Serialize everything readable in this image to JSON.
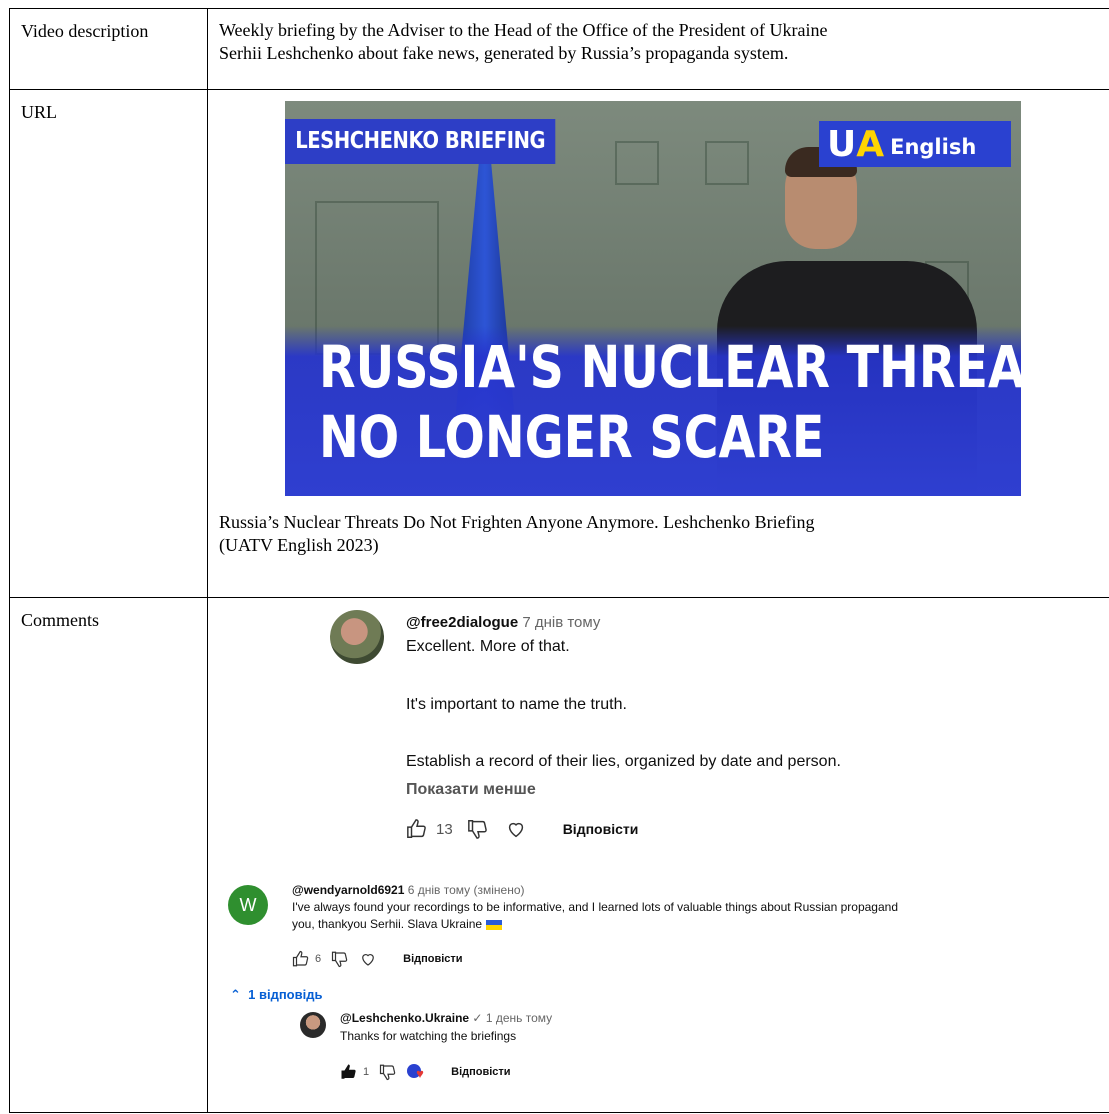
{
  "rows": {
    "description": {
      "label": "Video description",
      "text_line1": "Weekly briefing by the Adviser to the Head of the Office of the President of Ukraine",
      "text_line2": "Serhii Leshchenko about fake news, generated by Russia’s propaganda system."
    },
    "url": {
      "label": "URL",
      "thumbnail": {
        "badge": "LESHCHENKO BRIEFING",
        "logo_u": "U",
        "logo_a": "A",
        "logo_text": "English",
        "headline_line1": "RUSSIA'S NUCLEAR THREATS",
        "headline_line2": "NO LONGER SCARE"
      },
      "caption_line1": "Russia’s Nuclear Threats Do Not Frighten Anyone Anymore. Leshchenko Briefing",
      "caption_line2": "(UATV English 2023)"
    },
    "comments": {
      "label": "Comments",
      "items": [
        {
          "author": "@free2dialogue",
          "time": "7 днів тому",
          "lines": [
            "Excellent. More of that.",
            "It's important to name the truth.",
            "Establish a record of their lies, organized by date and person."
          ],
          "show_less": "Показати менше",
          "likes": "13",
          "reply_label": "Відповісти"
        },
        {
          "avatar_letter": "W",
          "author": "@wendyarnold6921",
          "time": "6 днів тому (змінено)",
          "line1": "I've always found your recordings to be informative, and I learned lots of valuable things about Russian propagand",
          "line2": "you, thankyou Serhii.  Slava Ukraine",
          "likes": "6",
          "reply_label": "Відповісти",
          "replies_toggle": "1 відповідь"
        },
        {
          "author": "@Leshchenko.Ukraine",
          "time": "1 день тому",
          "line1": "Thanks for watching the briefings",
          "likes": "1",
          "reply_label": "Відповісти"
        }
      ]
    }
  }
}
